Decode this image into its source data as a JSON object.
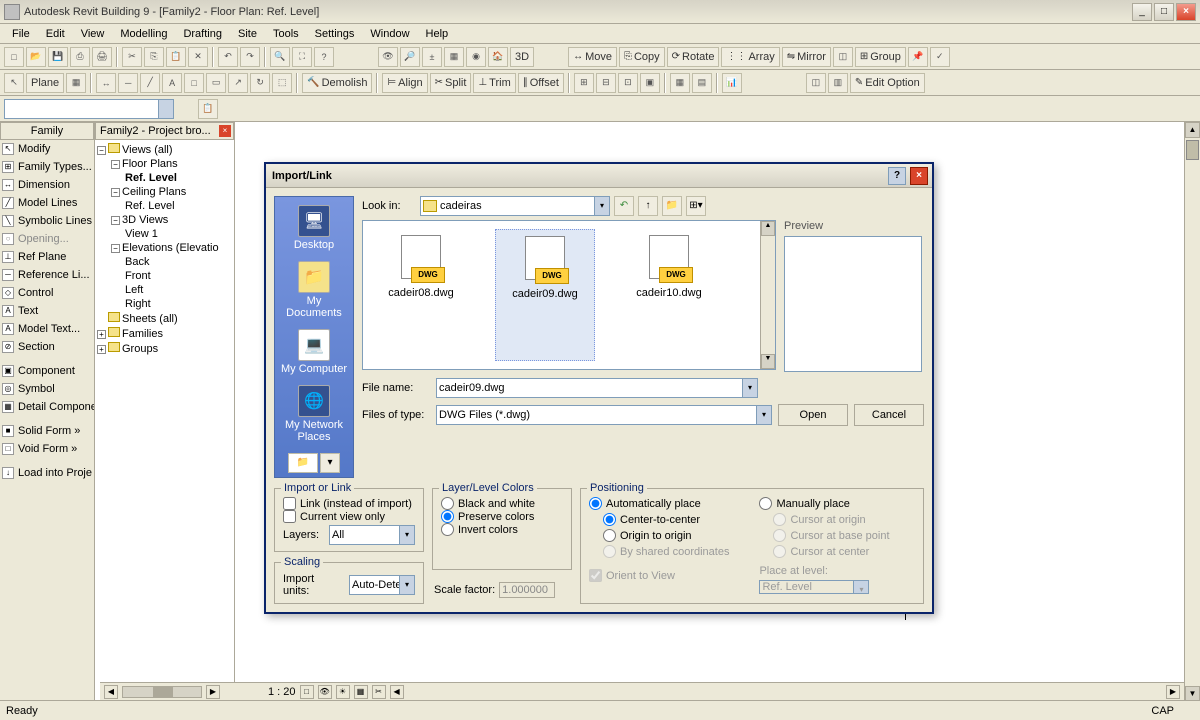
{
  "app": {
    "title": "Autodesk Revit Building 9 - [Family2 - Floor Plan: Ref. Level]"
  },
  "menu": [
    "File",
    "Edit",
    "View",
    "Modelling",
    "Drafting",
    "Site",
    "Tools",
    "Settings",
    "Window",
    "Help"
  ],
  "toolbar2_labels": {
    "move": "Move",
    "copy": "Copy",
    "rotate": "Rotate",
    "array": "Array",
    "mirror": "Mirror",
    "group": "Group",
    "d3": "3D"
  },
  "toolbar3_labels": {
    "plane": "Plane",
    "demolish": "Demolish",
    "align": "Align",
    "split": "Split",
    "trim": "Trim",
    "offset": "Offset",
    "editopt": "Edit Option"
  },
  "leftpanel": {
    "tab": "Family",
    "items": [
      "Modify",
      "Family Types...",
      "Dimension",
      "Model Lines",
      "Symbolic Lines",
      "Opening...",
      "Ref Plane",
      "Reference Li...",
      "Control",
      "Text",
      "Model Text...",
      "Section",
      "Component",
      "Symbol",
      "Detail Compone",
      "Solid Form »",
      "Void Form »",
      "Load into Proje"
    ]
  },
  "browser": {
    "tab": "Family2 - Project bro...",
    "views": "Views (all)",
    "floorplans": "Floor Plans",
    "reflevel": "Ref. Level",
    "ceilplans": "Ceiling Plans",
    "reflevel2": "Ref. Level",
    "d3views": "3D Views",
    "view1": "View 1",
    "elevations": "Elevations (Elevatio",
    "back": "Back",
    "front": "Front",
    "left": "Left",
    "right": "Right",
    "sheets": "Sheets (all)",
    "families": "Families",
    "groups": "Groups"
  },
  "dialog": {
    "title": "Import/Link",
    "lookin_label": "Look in:",
    "lookin_value": "cadeiras",
    "preview": "Preview",
    "places": [
      "Desktop",
      "My Documents",
      "My Computer",
      "My Network Places"
    ],
    "files": [
      {
        "name": "cadeir08.dwg",
        "badge": "DWG"
      },
      {
        "name": "cadeir09.dwg",
        "badge": "DWG",
        "sel": true
      },
      {
        "name": "cadeir10.dwg",
        "badge": "DWG"
      }
    ],
    "filename_label": "File name:",
    "filename": "cadeir09.dwg",
    "filetype_label": "Files of type:",
    "filetype": "DWG Files (*.dwg)",
    "open": "Open",
    "cancel": "Cancel",
    "importorlink": "Import or Link",
    "link_opt": "Link (instead of import)",
    "currentview": "Current view only",
    "layers_label": "Layers:",
    "layers_val": "All",
    "layercolors": "Layer/Level Colors",
    "bw": "Black and white",
    "preserve": "Preserve colors",
    "invert": "Invert colors",
    "scaling": "Scaling",
    "importunits_label": "Import units:",
    "importunits_val": "Auto-Detect",
    "scalefactor_label": "Scale factor:",
    "scalefactor_val": "1.000000",
    "positioning": "Positioning",
    "auto": "Automatically place",
    "manual": "Manually place",
    "ctc": "Center-to-center",
    "oto": "Origin to origin",
    "shared": "By shared coordinates",
    "cao": "Cursor at origin",
    "cabp": "Cursor at base point",
    "cac": "Cursor at center",
    "placeat": "Place at level:",
    "placeat_val": "Ref. Level",
    "orient": "Orient to View"
  },
  "viewbar": {
    "scale": "1 : 20"
  },
  "status": {
    "ready": "Ready",
    "cap": "CAP"
  }
}
